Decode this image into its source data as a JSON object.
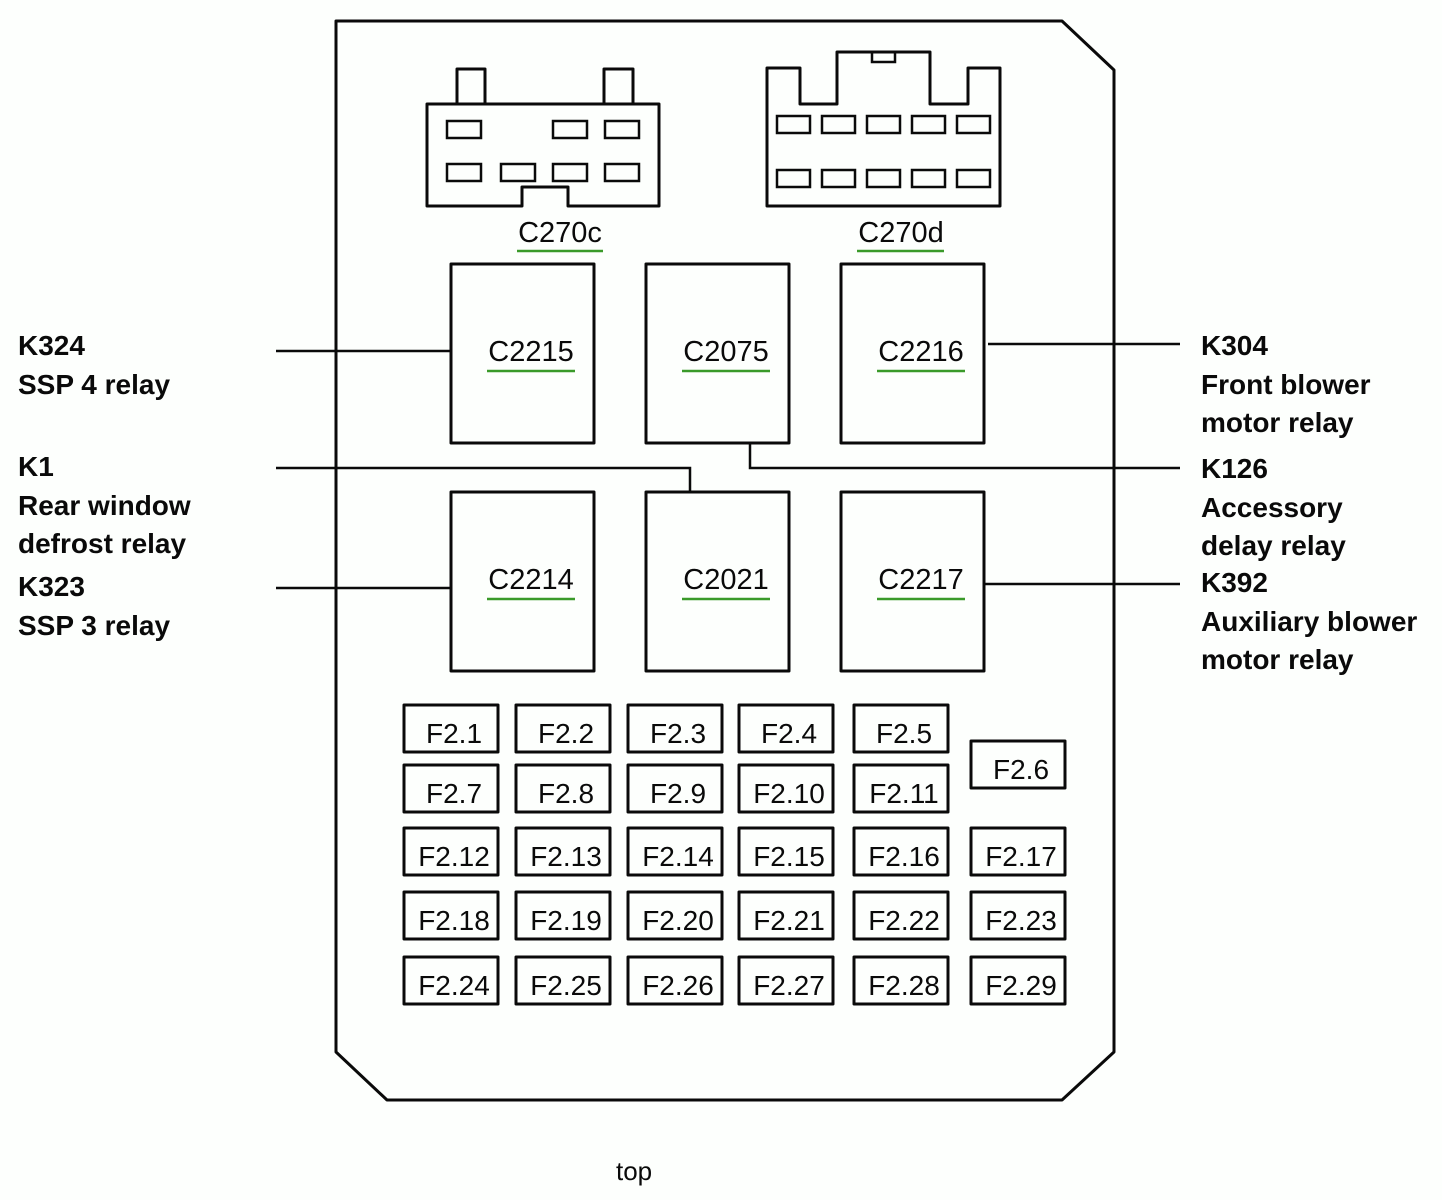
{
  "diagram": {
    "orientation_label": "top",
    "connectors": [
      {
        "id": "C270c",
        "label": "C270c"
      },
      {
        "id": "C270d",
        "label": "C270d"
      }
    ],
    "relay_sockets": [
      {
        "id": "C2215",
        "label": "C2215",
        "callout": {
          "code": "K324",
          "lines": [
            "SSP 4 relay"
          ]
        }
      },
      {
        "id": "C2075",
        "label": "C2075",
        "callout": {
          "code": "K126",
          "lines": [
            "Accessory",
            "delay relay"
          ]
        }
      },
      {
        "id": "C2216",
        "label": "C2216",
        "callout": {
          "code": "K304",
          "lines": [
            "Front blower",
            "motor relay"
          ]
        }
      },
      {
        "id": "C2214",
        "label": "C2214",
        "callout": {
          "code": "K323",
          "lines": [
            "SSP 3 relay"
          ]
        }
      },
      {
        "id": "C2021",
        "label": "C2021",
        "callout": {
          "code": "K1",
          "lines": [
            "Rear window",
            "defrost relay"
          ]
        }
      },
      {
        "id": "C2217",
        "label": "C2217",
        "callout": {
          "code": "K392",
          "lines": [
            "Auxiliary blower",
            "motor relay"
          ]
        }
      }
    ],
    "fuses": [
      "F2.1",
      "F2.2",
      "F2.3",
      "F2.4",
      "F2.5",
      "F2.6",
      "F2.7",
      "F2.8",
      "F2.9",
      "F2.10",
      "F2.11",
      "F2.12",
      "F2.13",
      "F2.14",
      "F2.15",
      "F2.16",
      "F2.17",
      "F2.18",
      "F2.19",
      "F2.20",
      "F2.21",
      "F2.22",
      "F2.23",
      "F2.24",
      "F2.25",
      "F2.26",
      "F2.27",
      "F2.28",
      "F2.29"
    ],
    "colors": {
      "line": "#0a0a0a",
      "underline": "#3a9a2a",
      "background": "#fdfffd"
    }
  }
}
